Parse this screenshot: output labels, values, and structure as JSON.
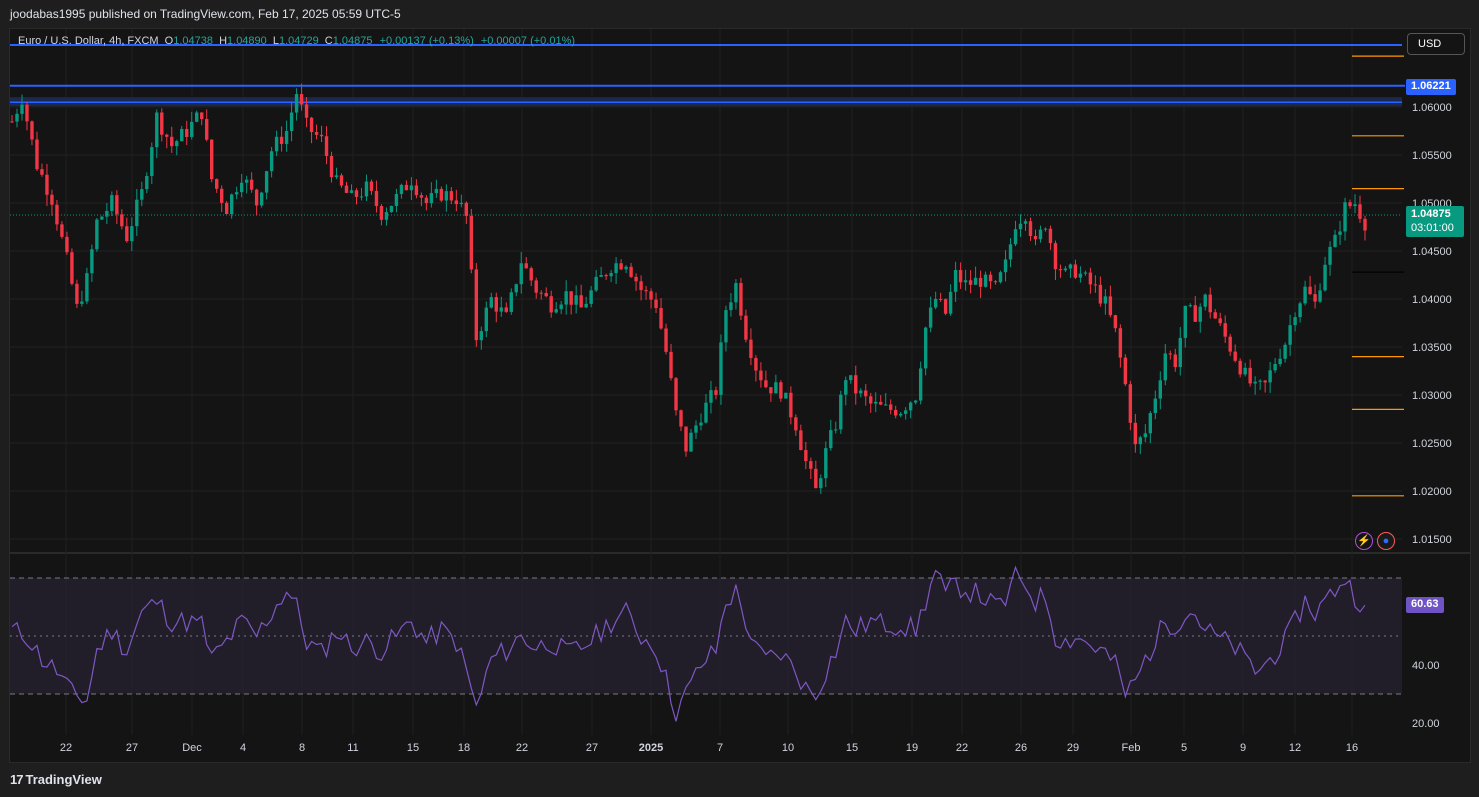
{
  "header": {
    "published": "joodabas1995 published on TradingView.com, Feb 17, 2025 05:59 UTC-5"
  },
  "legend": {
    "symbol": "Euro / U.S. Dollar, 4h, FXCM",
    "o_label": "O",
    "o": "1.04738",
    "h_label": "H",
    "h": "1.04890",
    "l_label": "L",
    "l": "1.04729",
    "c_label": "C",
    "c": "1.04875",
    "change": "+0.00137 (+0.13%)",
    "spread": "+0.00007 (+0.01%)"
  },
  "currency_button": "USD",
  "price_labels": {
    "level": "1.06221",
    "last": "1.04875",
    "countdown": "03:01:00",
    "rsi": "60.63"
  },
  "footer": {
    "logo_text": "TradingView",
    "logo_mark": "17"
  },
  "icons": {
    "bolt": "bolt-icon",
    "globe": "globe-icon"
  },
  "colors": {
    "up": "#089981",
    "down": "#f23645",
    "level_line": "#2962ff",
    "orange": "#ff9800",
    "rsi": "#7e57c2",
    "rsi_band": "#2a2438",
    "last_line": "#089981"
  },
  "chart_data": [
    {
      "type": "candlestick",
      "symbol": "EURUSD",
      "timeframe": "4h",
      "ylim": [
        1.012,
        1.066
      ],
      "y_ticks": [
        "1.06000",
        "1.05500",
        "1.05000",
        "1.04500",
        "1.04000",
        "1.03500",
        "1.03000",
        "1.02500",
        "1.02000",
        "1.01500"
      ],
      "x_ticks": [
        "22",
        "27",
        "Dec",
        "4",
        "8",
        "11",
        "15",
        "18",
        "22",
        "27",
        "2025",
        "7",
        "10",
        "15",
        "19",
        "22",
        "26",
        "29",
        "Feb",
        "5",
        "9",
        "12",
        "16"
      ],
      "x_ticks_bold": [
        "2025"
      ],
      "horizontal_levels": [
        {
          "price": 1.06221,
          "color": "#2962ff",
          "style": "solid"
        },
        {
          "price": 1.0605,
          "color": "#2962ff",
          "style": "band"
        }
      ],
      "orange_marks": [
        1.0653,
        1.057,
        1.0515,
        1.034,
        1.0285,
        1.0195
      ],
      "black_mark": 1.0428,
      "last_price": 1.04875,
      "path": [
        [
          0,
          1.0585
        ],
        [
          2,
          1.061
        ],
        [
          5,
          1.054
        ],
        [
          8,
          1.0505
        ],
        [
          11,
          1.044
        ],
        [
          13,
          1.039
        ],
        [
          15,
          1.042
        ],
        [
          17,
          1.048
        ],
        [
          20,
          1.05
        ],
        [
          23,
          1.0465
        ],
        [
          26,
          1.051
        ],
        [
          29,
          1.059
        ],
        [
          32,
          1.056
        ],
        [
          35,
          1.0575
        ],
        [
          38,
          1.0595
        ],
        [
          40,
          1.0525
        ],
        [
          43,
          1.0495
        ],
        [
          46,
          1.053
        ],
        [
          49,
          1.05
        ],
        [
          52,
          1.0555
        ],
        [
          55,
          1.0575
        ],
        [
          57,
          1.0615
        ],
        [
          59,
          1.058
        ],
        [
          62,
          1.0565
        ],
        [
          65,
          1.052
        ],
        [
          68,
          1.0505
        ],
        [
          71,
          1.0515
        ],
        [
          74,
          1.049
        ],
        [
          77,
          1.0505
        ],
        [
          80,
          1.0525
        ],
        [
          83,
          1.05
        ],
        [
          86,
          1.051
        ],
        [
          89,
          1.0505
        ],
        [
          91,
          1.0485
        ],
        [
          93,
          1.036
        ],
        [
          96,
          1.04
        ],
        [
          99,
          1.038
        ],
        [
          102,
          1.044
        ],
        [
          105,
          1.041
        ],
        [
          108,
          1.0395
        ],
        [
          111,
          1.0405
        ],
        [
          114,
          1.039
        ],
        [
          117,
          1.0415
        ],
        [
          120,
          1.0435
        ],
        [
          123,
          1.044
        ],
        [
          126,
          1.041
        ],
        [
          129,
          1.0395
        ],
        [
          131,
          1.0345
        ],
        [
          133,
          1.028
        ],
        [
          135,
          1.0245
        ],
        [
          138,
          1.028
        ],
        [
          141,
          1.0305
        ],
        [
          143,
          1.039
        ],
        [
          145,
          1.0415
        ],
        [
          147,
          1.0365
        ],
        [
          149,
          1.033
        ],
        [
          151,
          1.031
        ],
        [
          154,
          1.0305
        ],
        [
          157,
          1.027
        ],
        [
          159,
          1.023
        ],
        [
          161,
          1.02
        ],
        [
          163,
          1.024
        ],
        [
          165,
          1.027
        ],
        [
          167,
          1.032
        ],
        [
          169,
          1.0305
        ],
        [
          172,
          1.029
        ],
        [
          175,
          1.0285
        ],
        [
          178,
          1.0285
        ],
        [
          181,
          1.03
        ],
        [
          183,
          1.037
        ],
        [
          185,
          1.04
        ],
        [
          187,
          1.0385
        ],
        [
          189,
          1.0425
        ],
        [
          191,
          1.0415
        ],
        [
          194,
          1.042
        ],
        [
          197,
          1.041
        ],
        [
          199,
          1.0435
        ],
        [
          201,
          1.048
        ],
        [
          203,
          1.049
        ],
        [
          205,
          1.0455
        ],
        [
          207,
          1.048
        ],
        [
          209,
          1.044
        ],
        [
          211,
          1.0425
        ],
        [
          213,
          1.043
        ],
        [
          215,
          1.042
        ],
        [
          217,
          1.041
        ],
        [
          219,
          1.0395
        ],
        [
          221,
          1.0365
        ],
        [
          223,
          1.031
        ],
        [
          225,
          1.0245
        ],
        [
          227,
          1.026
        ],
        [
          229,
          1.03
        ],
        [
          231,
          1.0345
        ],
        [
          233,
          1.0335
        ],
        [
          235,
          1.0385
        ],
        [
          237,
          1.0385
        ],
        [
          239,
          1.04
        ],
        [
          241,
          1.038
        ],
        [
          243,
          1.036
        ],
        [
          245,
          1.034
        ],
        [
          247,
          1.032
        ],
        [
          249,
          1.0305
        ],
        [
          251,
          1.031
        ],
        [
          253,
          1.0335
        ],
        [
          255,
          1.0355
        ],
        [
          257,
          1.039
        ],
        [
          259,
          1.041
        ],
        [
          261,
          1.0395
        ],
        [
          263,
          1.044
        ],
        [
          265,
          1.046
        ],
        [
          267,
          1.0495
        ],
        [
          269,
          1.05
        ],
        [
          271,
          1.048
        ]
      ]
    },
    {
      "type": "line",
      "name": "RSI",
      "ylim": [
        15,
        78
      ],
      "y_ticks": [
        "40.00",
        "20.00"
      ],
      "bands": [
        70,
        50,
        30
      ],
      "last_value": 60.63,
      "path": [
        [
          0,
          52
        ],
        [
          3,
          50
        ],
        [
          6,
          42
        ],
        [
          9,
          38
        ],
        [
          12,
          30
        ],
        [
          15,
          28
        ],
        [
          17,
          45
        ],
        [
          20,
          52
        ],
        [
          23,
          45
        ],
        [
          26,
          58
        ],
        [
          29,
          62
        ],
        [
          32,
          55
        ],
        [
          35,
          55
        ],
        [
          38,
          54
        ],
        [
          40,
          42
        ],
        [
          43,
          48
        ],
        [
          46,
          55
        ],
        [
          49,
          50
        ],
        [
          52,
          58
        ],
        [
          55,
          66
        ],
        [
          57,
          60
        ],
        [
          59,
          48
        ],
        [
          62,
          44
        ],
        [
          65,
          52
        ],
        [
          68,
          46
        ],
        [
          71,
          48
        ],
        [
          74,
          45
        ],
        [
          77,
          50
        ],
        [
          80,
          55
        ],
        [
          83,
          48
        ],
        [
          86,
          52
        ],
        [
          89,
          48
        ],
        [
          91,
          38
        ],
        [
          93,
          25
        ],
        [
          96,
          42
        ],
        [
          99,
          45
        ],
        [
          102,
          50
        ],
        [
          105,
          46
        ],
        [
          108,
          48
        ],
        [
          111,
          44
        ],
        [
          114,
          46
        ],
        [
          117,
          50
        ],
        [
          120,
          55
        ],
        [
          123,
          58
        ],
        [
          126,
          50
        ],
        [
          129,
          46
        ],
        [
          131,
          35
        ],
        [
          133,
          24
        ],
        [
          135,
          30
        ],
        [
          138,
          40
        ],
        [
          141,
          45
        ],
        [
          143,
          62
        ],
        [
          145,
          65
        ],
        [
          147,
          55
        ],
        [
          149,
          45
        ],
        [
          151,
          42
        ],
        [
          154,
          44
        ],
        [
          157,
          38
        ],
        [
          159,
          32
        ],
        [
          161,
          30
        ],
        [
          163,
          38
        ],
        [
          165,
          45
        ],
        [
          167,
          55
        ],
        [
          169,
          52
        ],
        [
          172,
          55
        ],
        [
          175,
          54
        ],
        [
          178,
          54
        ],
        [
          181,
          52
        ],
        [
          183,
          62
        ],
        [
          185,
          72
        ],
        [
          187,
          64
        ],
        [
          189,
          68
        ],
        [
          191,
          66
        ],
        [
          194,
          64
        ],
        [
          197,
          60
        ],
        [
          199,
          62
        ],
        [
          201,
          70
        ],
        [
          203,
          68
        ],
        [
          205,
          62
        ],
        [
          207,
          64
        ],
        [
          209,
          50
        ],
        [
          211,
          48
        ],
        [
          213,
          50
        ],
        [
          215,
          48
        ],
        [
          217,
          46
        ],
        [
          219,
          44
        ],
        [
          221,
          40
        ],
        [
          223,
          30
        ],
        [
          225,
          34
        ],
        [
          227,
          42
        ],
        [
          229,
          48
        ],
        [
          231,
          55
        ],
        [
          233,
          54
        ],
        [
          235,
          58
        ],
        [
          237,
          58
        ],
        [
          239,
          52
        ],
        [
          241,
          50
        ],
        [
          243,
          48
        ],
        [
          245,
          46
        ],
        [
          247,
          42
        ],
        [
          249,
          38
        ],
        [
          251,
          40
        ],
        [
          253,
          44
        ],
        [
          255,
          48
        ],
        [
          257,
          55
        ],
        [
          259,
          62
        ],
        [
          261,
          58
        ],
        [
          263,
          62
        ],
        [
          265,
          66
        ],
        [
          267,
          70
        ],
        [
          269,
          64
        ],
        [
          271,
          60.63
        ]
      ]
    }
  ]
}
